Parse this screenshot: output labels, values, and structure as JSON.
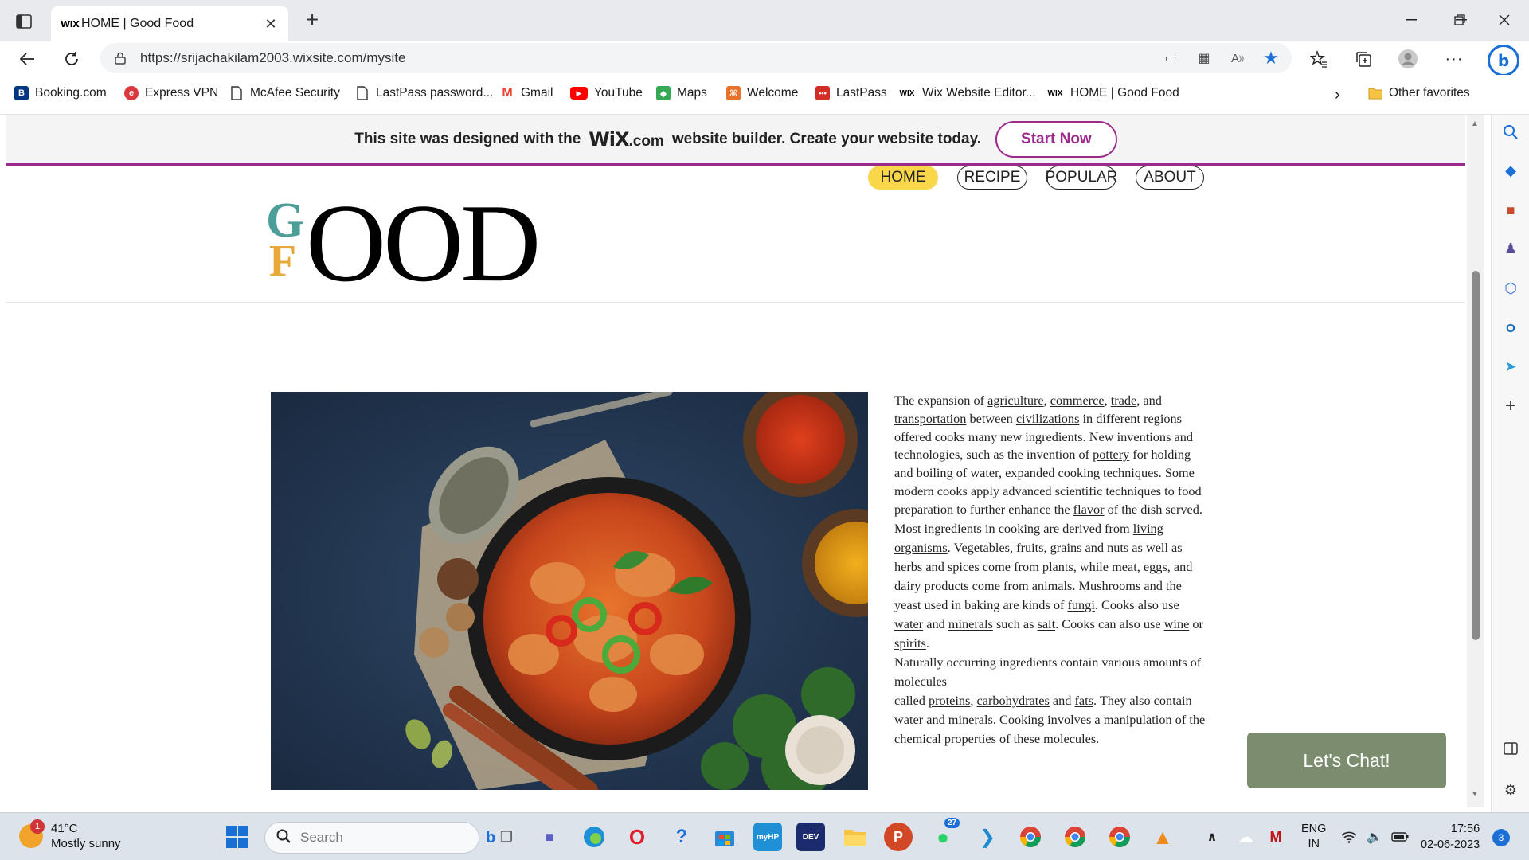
{
  "browser": {
    "tab_title": "HOME | Good Food",
    "tab_favicon": "WIX",
    "url": "https://srijachakilam2003.wixsite.com/mysite",
    "favorites": [
      {
        "label": "Booking.com",
        "icon": "booking-icon",
        "color": "#003580"
      },
      {
        "label": "Express VPN",
        "icon": "expressvpn-icon",
        "color": "#da3940"
      },
      {
        "label": "McAfee Security",
        "icon": "page-icon",
        "color": "#555555"
      },
      {
        "label": "LastPass password...",
        "icon": "page-icon",
        "color": "#555555"
      },
      {
        "label": "Gmail",
        "icon": "gmail-icon",
        "color": "#ea4335"
      },
      {
        "label": "YouTube",
        "icon": "youtube-icon",
        "color": "#ff0000"
      },
      {
        "label": "Maps",
        "icon": "maps-icon",
        "color": "#34a853"
      },
      {
        "label": "Welcome",
        "icon": "welcome-icon",
        "color": "#e8712c"
      },
      {
        "label": "LastPass",
        "icon": "lastpass-icon",
        "color": "#d32d27"
      },
      {
        "label": "Wix Website Editor...",
        "icon": "wix-icon",
        "color": "#000000"
      },
      {
        "label": "HOME | Good Food",
        "icon": "wix-icon",
        "color": "#000000"
      }
    ],
    "other_favorites": "Other favorites"
  },
  "site": {
    "banner": {
      "text_before": "This site was designed with the",
      "wix_logo": "WiX",
      "wix_suffix": ".com",
      "text_after": "website builder. Create your website today.",
      "cta": "Start Now"
    },
    "logo": {
      "letter_top": "G",
      "letter_bottom": "F",
      "word": "OOD"
    },
    "menu": [
      {
        "label": "HOME",
        "active": true
      },
      {
        "label": "RECIPE",
        "active": false
      },
      {
        "label": "POPULAR",
        "active": false
      },
      {
        "label": "ABOUT",
        "active": false
      }
    ],
    "chat_button": "Let's Chat!",
    "colors": {
      "accent": "#9b2a8b",
      "menu_active": "#f9d64a",
      "chat": "#7c8c6f",
      "logo_g": "#4c9e98",
      "logo_f": "#e7a93a"
    }
  },
  "taskbar": {
    "weather_temp": "41°C",
    "weather_desc": "Mostly sunny",
    "weather_badge": "1",
    "search_placeholder": "Search",
    "lang_top": "ENG",
    "lang_bottom": "IN",
    "time": "17:56",
    "date": "02-06-2023",
    "notifications": "3",
    "whatsapp_badge": "27"
  }
}
